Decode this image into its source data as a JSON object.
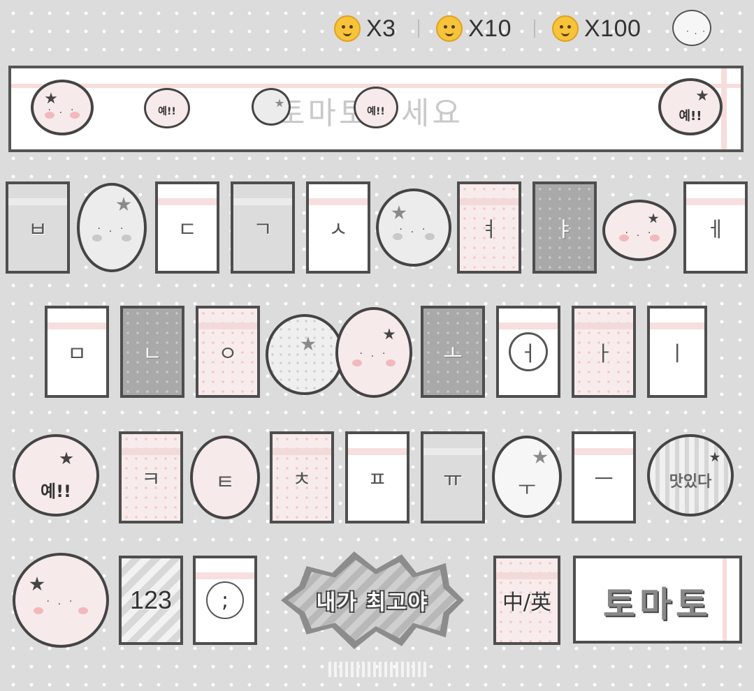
{
  "top_bar": {
    "rewards": [
      {
        "icon": "hugging-face-icon",
        "label": "X3"
      },
      {
        "icon": "hugging-face-icon",
        "label": "X10"
      },
      {
        "icon": "hugging-face-icon",
        "label": "X100"
      }
    ],
    "avatar_face": "· . ·"
  },
  "input_bar": {
    "placeholder": "토마토주세요",
    "stickers": [
      "· . ·",
      "예!!",
      "예!!",
      "예!!"
    ]
  },
  "rows": {
    "row1": [
      "ㅂ",
      "ㄷ",
      "ㄱ",
      "ㅅ",
      "ㅕ",
      "ㅑ",
      "ㅔ"
    ],
    "row2": [
      "ㅁ",
      "ㄴ",
      "ㅇ",
      "ㅗ",
      "ㅓ",
      "ㅏ",
      "ㅣ"
    ],
    "row3": [
      "ㅋ",
      "ㅌ",
      "ㅊ",
      "ㅍ",
      "ㅠ",
      "ㅜ",
      "ㅡ"
    ]
  },
  "stickers": {
    "row3_left": "예!!",
    "row3_right": "맛있다"
  },
  "bottom": {
    "numbers": "123",
    "punct": ";",
    "space_label": "내가 최고야",
    "lang": "中/英",
    "enter": "토마토"
  },
  "colors": {
    "background": "#dcdcdc",
    "key_border": "#4e4e4e",
    "pink": "#f8ebeb",
    "accent_pink": "#f7dcdc",
    "dark_key": "#a9a9a9"
  }
}
